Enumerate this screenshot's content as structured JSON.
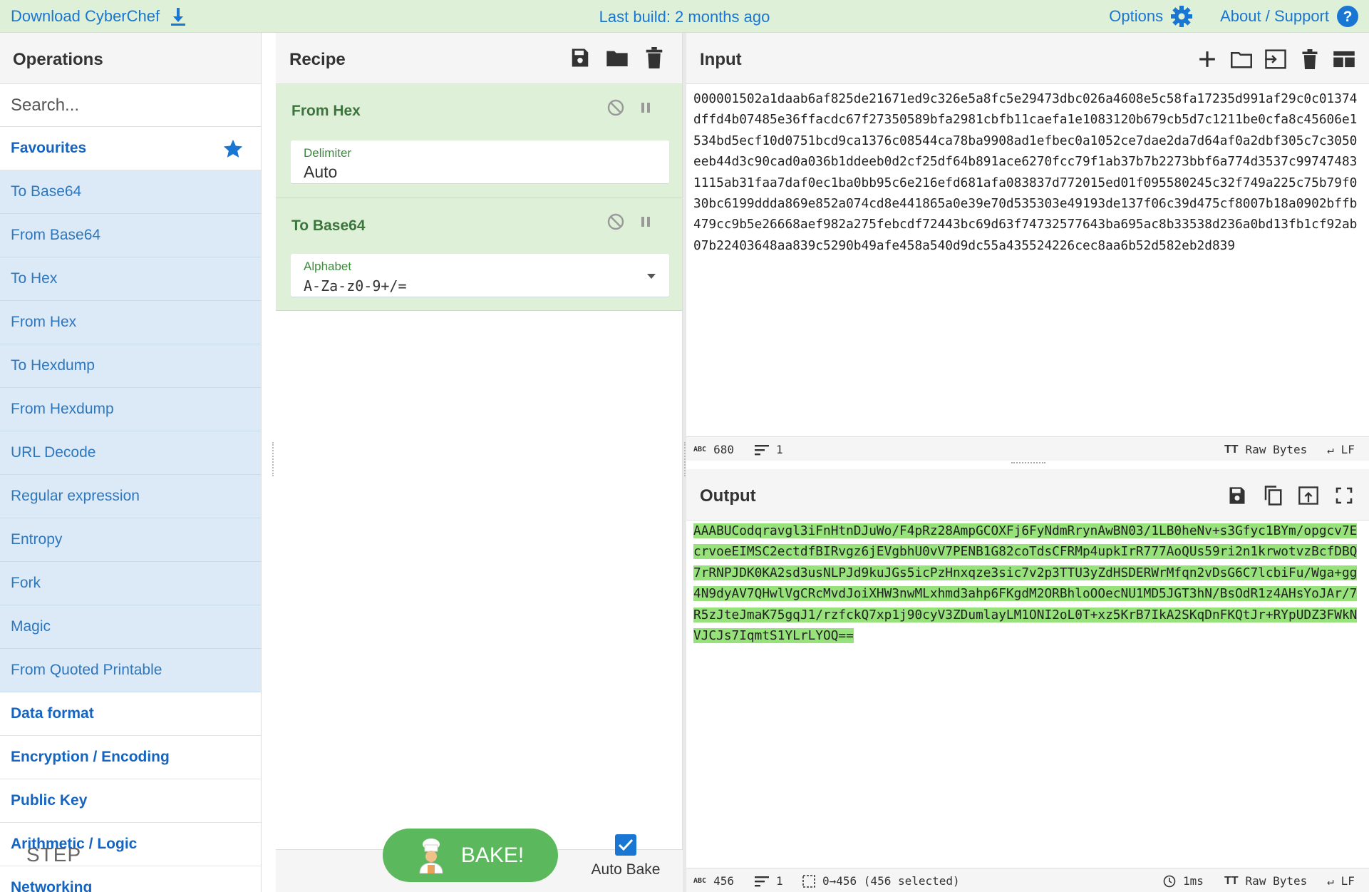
{
  "banner": {
    "download_label": "Download CyberChef",
    "last_build": "Last build: 2 months ago",
    "options_label": "Options",
    "about_label": "About / Support"
  },
  "operations": {
    "title": "Operations",
    "search_placeholder": "Search...",
    "favourites_label": "Favourites",
    "items": [
      "To Base64",
      "From Base64",
      "To Hex",
      "From Hex",
      "To Hexdump",
      "From Hexdump",
      "URL Decode",
      "Regular expression",
      "Entropy",
      "Fork",
      "Magic",
      "From Quoted Printable"
    ],
    "categories": [
      "Data format",
      "Encryption / Encoding",
      "Public Key",
      "Arithmetic / Logic",
      "Networking"
    ]
  },
  "recipe": {
    "title": "Recipe",
    "ops": [
      {
        "name": "From Hex",
        "arg_label": "Delimiter",
        "arg_value": "Auto"
      },
      {
        "name": "To Base64",
        "arg_label": "Alphabet",
        "arg_value": "A-Za-z0-9+/="
      }
    ],
    "step_label": "STEP",
    "bake_label": "BAKE!",
    "autobake_label": "Auto Bake",
    "autobake_checked": true
  },
  "input": {
    "title": "Input",
    "text": "000001502a1daab6af825de21671ed9c326e5a8fc5e29473dbc026a4608e5c58fa17235d991af29c0c01374dffd4b07485e36ffacdc67f27350589bfa2981cbfb11caefa1e1083120b679cb5d7c1211be0cfa8c45606e1534bd5ecf10d0751bcd9ca1376c08544ca78ba9908ad1efbec0a1052ce7dae2da7d64af0a2dbf305c7c3050eeb44d3c90cad0a036b1ddeeb0d2cf25df64b891ace6270fcc79f1ab37b7b2273bbf6a774d3537c997474831115ab31faa7daf0ec1ba0bb95c6e216efd681afa083837d772015ed01f095580245c32f749a225c75b79f030bc6199ddda869e852a074cd8e441865a0e39e70d535303e49193de137f06c39d475cf8007b18a0902bffb479cc9b5e26668aef982a275febcdf72443bc69d63f74732577643ba695ac8b33538d236a0bd13fb1cf92ab07b22403648aa839c5290b49afe458a540d9dc55a435524226cec8aa6b52d582eb2d839",
    "status": {
      "length": "680",
      "lines": "1",
      "encoding": "Raw Bytes",
      "eol": "LF"
    }
  },
  "output": {
    "title": "Output",
    "text": "AAABUCodqravgl3iFnHtnDJuWo/F4pRz28AmpGCOXFj6FyNdmRrynAwBN03/1LB0heNv+s3Gfyc1BYm/opgcv7EcrvoeEIMSC2ectdfBIRvgz6jEVgbhU0vV7PENB1G82coTdsCFRMp4upkIrR777AoQUs59ri2n1krwotvzBcfDBQ7rRNPJDK0KA2sd3usNLPJd9kuJGs5icPzHnxqze3sic7v2p3TTU3yZdHSDERWrMfqn2vDsG6C7lcbiFu/Wga+gg4N9dyAV7QHwlVgCRcMvdJoiXHW3nwMLxhmd3ahp6FKgdM2ORBhloOOecNU1MD5JGT3hN/BsOdR1z4AHsYoJAr/7R5zJteJmaK75gqJ1/rzfckQ7xp1j90cyV3ZDumlayLM1ONI2oL0T+xz5KrB7IkA2SKqDnFKQtJr+RYpUDZ3FWkNVJCJs7IqmtS1YLrLYOQ==",
    "status": {
      "length": "456",
      "lines": "1",
      "selection": "0→456 (456 selected)",
      "time": "1ms",
      "encoding": "Raw Bytes",
      "eol": "LF"
    }
  },
  "colors": {
    "accent": "#1976d2",
    "bake": "#5cb85c",
    "recipe_bg": "#dff0d8",
    "fav_bg": "#dbeaf6",
    "highlight": "#98e27c"
  }
}
